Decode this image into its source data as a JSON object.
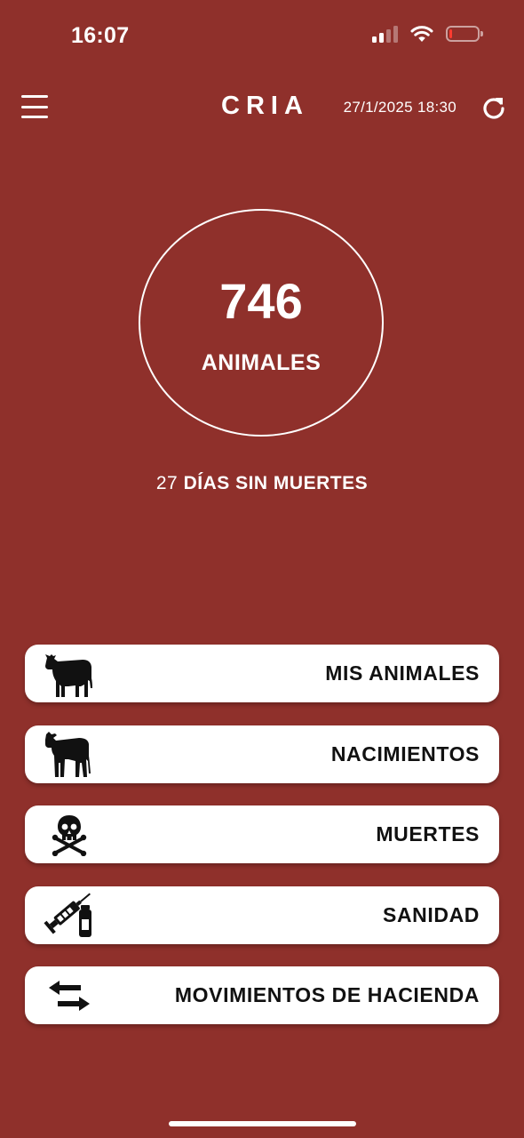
{
  "status_bar": {
    "time": "16:07",
    "battery_level": 0.1,
    "battery_color": "#ff3b30"
  },
  "header": {
    "menu_icon": "hamburger-menu-icon",
    "title": "CRIA",
    "timestamp": "27/1/2025 18:30",
    "refresh_icon": "refresh-icon"
  },
  "counter": {
    "value": "746",
    "label": "ANIMALES"
  },
  "streak": {
    "days": "27",
    "text": "DÍAS SIN MUERTES"
  },
  "menu": [
    {
      "label": "MIS ANIMALES",
      "icon": "cow-icon"
    },
    {
      "label": "NACIMIENTOS",
      "icon": "calf-icon"
    },
    {
      "label": "MUERTES",
      "icon": "skull-crossbones-icon"
    },
    {
      "label": "SANIDAD",
      "icon": "syringe-vial-icon"
    },
    {
      "label": "MOVIMIENTOS DE HACIENDA",
      "icon": "transfer-arrows-icon"
    }
  ],
  "colors": {
    "background": "#8f302b",
    "card": "#ffffff",
    "card_text": "#111111",
    "text": "#ffffff"
  }
}
